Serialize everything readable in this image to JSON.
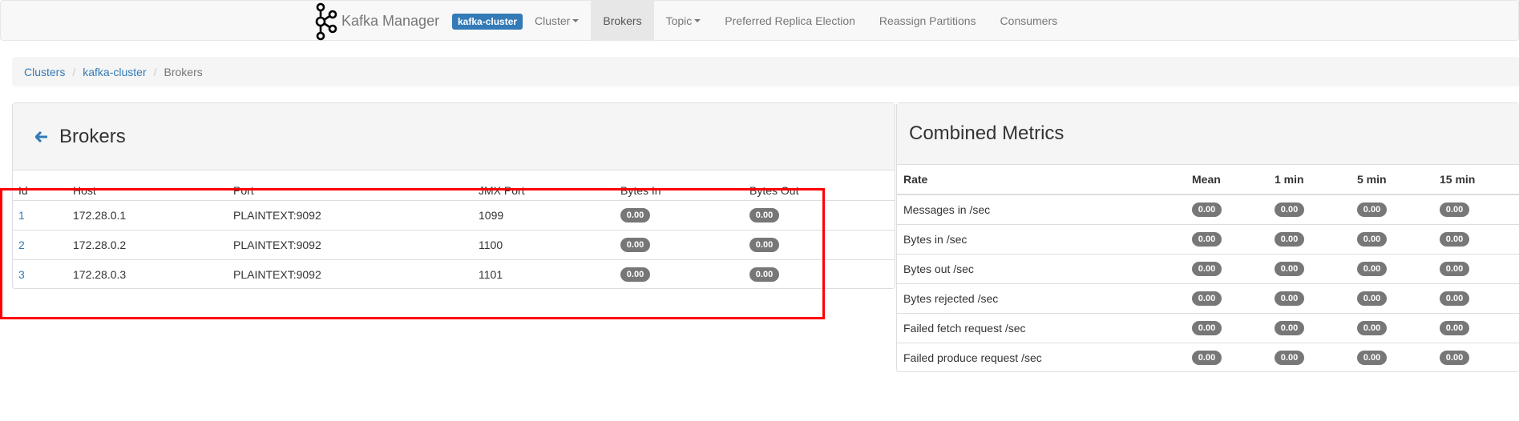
{
  "navbar": {
    "brand": "Kafka Manager",
    "cluster_badge": "kafka-cluster",
    "items": [
      {
        "label": "Cluster",
        "dropdown": true,
        "active": false
      },
      {
        "label": "Brokers",
        "dropdown": false,
        "active": true
      },
      {
        "label": "Topic",
        "dropdown": true,
        "active": false
      },
      {
        "label": "Preferred Replica Election",
        "dropdown": false,
        "active": false
      },
      {
        "label": "Reassign Partitions",
        "dropdown": false,
        "active": false
      },
      {
        "label": "Consumers",
        "dropdown": false,
        "active": false
      }
    ]
  },
  "breadcrumb": {
    "items": [
      "Clusters",
      "kafka-cluster"
    ],
    "current": "Brokers"
  },
  "brokers": {
    "title": "Brokers",
    "columns": [
      "Id",
      "Host",
      "Port",
      "JMX Port",
      "Bytes In",
      "Bytes Out"
    ],
    "rows": [
      {
        "id": "1",
        "host": "172.28.0.1",
        "port": "PLAINTEXT:9092",
        "jmx": "1099",
        "bytes_in": "0.00",
        "bytes_out": "0.00"
      },
      {
        "id": "2",
        "host": "172.28.0.2",
        "port": "PLAINTEXT:9092",
        "jmx": "1100",
        "bytes_in": "0.00",
        "bytes_out": "0.00"
      },
      {
        "id": "3",
        "host": "172.28.0.3",
        "port": "PLAINTEXT:9092",
        "jmx": "1101",
        "bytes_in": "0.00",
        "bytes_out": "0.00"
      }
    ]
  },
  "metrics": {
    "title": "Combined Metrics",
    "columns": [
      "Rate",
      "Mean",
      "1 min",
      "5 min",
      "15 min"
    ],
    "rows": [
      {
        "rate": "Messages in /sec",
        "mean": "0.00",
        "m1": "0.00",
        "m5": "0.00",
        "m15": "0.00"
      },
      {
        "rate": "Bytes in /sec",
        "mean": "0.00",
        "m1": "0.00",
        "m5": "0.00",
        "m15": "0.00"
      },
      {
        "rate": "Bytes out /sec",
        "mean": "0.00",
        "m1": "0.00",
        "m5": "0.00",
        "m15": "0.00"
      },
      {
        "rate": "Bytes rejected /sec",
        "mean": "0.00",
        "m1": "0.00",
        "m5": "0.00",
        "m15": "0.00"
      },
      {
        "rate": "Failed fetch request /sec",
        "mean": "0.00",
        "m1": "0.00",
        "m5": "0.00",
        "m15": "0.00"
      },
      {
        "rate": "Failed produce request /sec",
        "mean": "0.00",
        "m1": "0.00",
        "m5": "0.00",
        "m15": "0.00"
      }
    ]
  },
  "colors": {
    "link": "#337ab7",
    "badge": "#777777",
    "highlight": "#ff0000",
    "navbar_bg": "#f8f8f8",
    "active_nav_bg": "#e7e7e7"
  }
}
